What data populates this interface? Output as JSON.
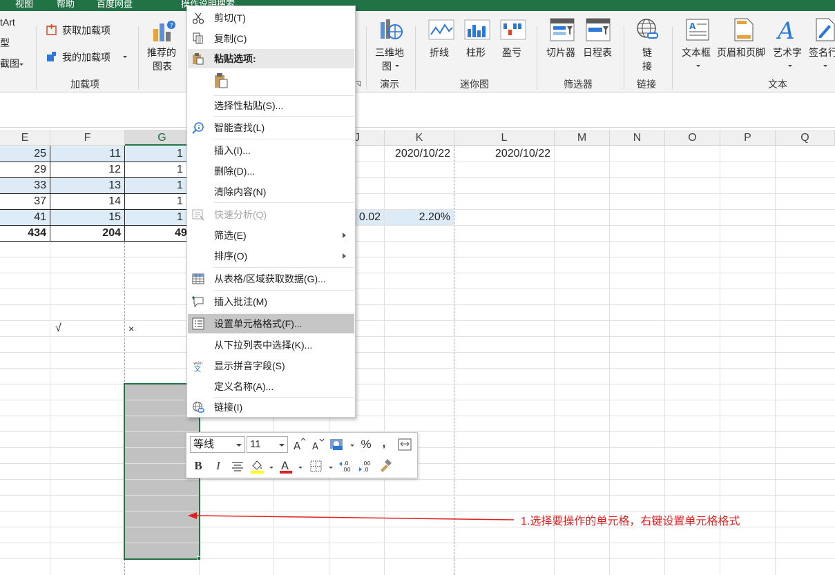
{
  "ribbon": {
    "top_tabs": [
      "视图",
      "帮助",
      "百度网盘",
      "操作说明搜索"
    ],
    "left_clip_items": [
      "tArt",
      "型",
      "截图"
    ],
    "addins": {
      "get_label": "获取加载项",
      "my_label": "我的加载项",
      "group_label": "加载项"
    },
    "charts": {
      "recommended_line1": "推荐的",
      "recommended_line2": "图表"
    },
    "tours": {
      "map_line1": "三维地",
      "map_line2": "图",
      "group_label": "演示"
    },
    "sparklines": {
      "line": "折线",
      "column": "柱形",
      "winloss": "盈亏",
      "group_label": "迷你图"
    },
    "filters": {
      "slicer": "切片器",
      "timeline": "日程表",
      "group_label": "筛选器"
    },
    "links": {
      "link_line1": "链",
      "link_line2": "接",
      "group_label": "链接"
    },
    "text": {
      "textbox": "文本框",
      "header_footer": "页眉和页脚",
      "wordart": "艺术字",
      "signature": "签名行",
      "group_label": "文本"
    }
  },
  "columns": [
    "E",
    "F",
    "G",
    "J",
    "K",
    "L",
    "M",
    "N",
    "O",
    "P",
    "Q"
  ],
  "cells": {
    "e": [
      "25",
      "29",
      "33",
      "37",
      "41",
      "434"
    ],
    "f": [
      "11",
      "12",
      "13",
      "14",
      "15",
      "204"
    ],
    "g_partial": [
      "1",
      "1",
      "1",
      "1",
      "1",
      "49"
    ],
    "k1": "2020/10/22",
    "l1": "2020/10/22",
    "j5": "0.02",
    "k5": "2.20%",
    "f12": "√",
    "g12": "×"
  },
  "context_menu": {
    "cut": "剪切(T)",
    "copy": "复制(C)",
    "paste_options": "粘贴选项:",
    "paste_special": "选择性粘贴(S)...",
    "smart_lookup": "智能查找(L)",
    "insert": "插入(I)...",
    "delete": "删除(D)...",
    "clear": "清除内容(N)",
    "quick_analysis": "快速分析(Q)",
    "filter": "筛选(E)",
    "sort": "排序(O)",
    "get_data": "从表格/区域获取数据(G)...",
    "insert_comment": "插入批注(M)",
    "format_cells": "设置单元格格式(F)...",
    "pick_list": "从下拉列表中选择(K)...",
    "phonetic": "显示拼音字段(S)",
    "define_name": "定义名称(A)...",
    "link": "链接(I)"
  },
  "mini_toolbar": {
    "font": "等线",
    "size": "11",
    "bold": "B",
    "italic": "I",
    "percent": "%",
    "comma": ","
  },
  "annotation": "1.选择要操作的单元格，右键设置单元格格式",
  "colors": {
    "excel_green": "#217346",
    "selection_gray": "#c2c2c2",
    "annotation_red": "#e02020",
    "row_blue": "#ddebf7"
  }
}
